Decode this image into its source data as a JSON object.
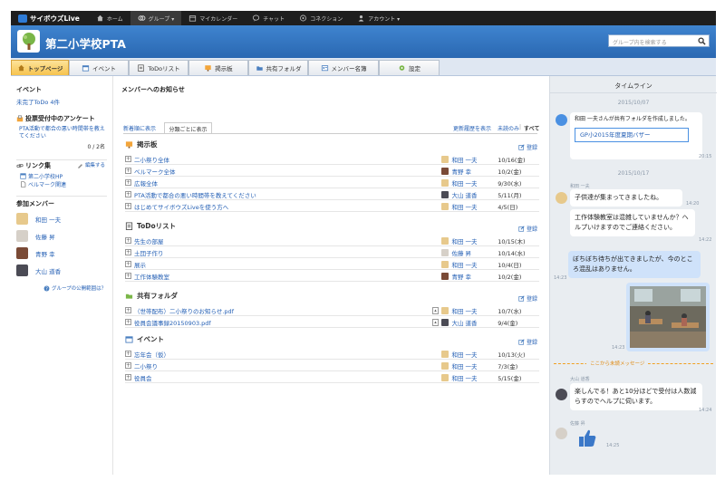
{
  "topbar": {
    "brand": "サイボウズLive",
    "nav": [
      {
        "label": "ホーム",
        "icon": "home-icon"
      },
      {
        "label": "グループ ▾",
        "icon": "group-icon"
      },
      {
        "label": "マイカレンダー",
        "icon": "calendar-icon"
      },
      {
        "label": "チャット",
        "icon": "chat-icon"
      },
      {
        "label": "コネクション",
        "icon": "connection-icon"
      },
      {
        "label": "アカウント ▾",
        "icon": "account-icon"
      }
    ]
  },
  "header": {
    "group_name": "第二小学校PTA",
    "search_placeholder": "グループ内を検索する"
  },
  "tabs": [
    {
      "label": "トップページ",
      "icon": "home-icon"
    },
    {
      "label": "イベント",
      "icon": "event-icon"
    },
    {
      "label": "ToDoリスト",
      "icon": "todo-icon"
    },
    {
      "label": "掲示板",
      "icon": "board-icon"
    },
    {
      "label": "共有フォルダ",
      "icon": "folder-icon"
    },
    {
      "label": "メンバー名簿",
      "icon": "members-icon"
    },
    {
      "label": "設定",
      "icon": "settings-icon"
    }
  ],
  "left": {
    "event_title": "イベント",
    "todo_incomplete": "未完了ToDo 4件",
    "survey_title": "投票受付中のアンケート",
    "survey_item": "PTA活動で都合の悪い時間帯を教えてください",
    "survey_count": "0 / 2名",
    "links_title": "リンク集",
    "links_edit": "編集する",
    "links": [
      "第二小学校HP",
      "ベルマーク関連"
    ],
    "members_title": "参加メンバー",
    "members": [
      "和田 一夫",
      "佐藤 昇",
      "青野 幸",
      "大山 道香"
    ],
    "public_scope": "グループの公開範囲は？"
  },
  "mid": {
    "title": "メンバーへのお知らせ",
    "view_newest": "新着順に表示",
    "view_category": "分類ごとに表示",
    "show_history": "更新履歴を表示",
    "unread_only": "未読のみ",
    "all": "すべて",
    "register": "登録",
    "categories": [
      {
        "name": "掲示板",
        "icon": "board-icon",
        "rows": [
          {
            "title": "二小祭り全体",
            "who": "和田 一夫",
            "date": "10/16(金)"
          },
          {
            "title": "ベルマーク全体",
            "who": "青野 幸",
            "date": "10/2(金)"
          },
          {
            "title": "広報全体",
            "who": "和田 一夫",
            "date": "9/30(水)"
          },
          {
            "title": "PTA活動で都合の悪い時間帯を教えてください",
            "who": "大山 道香",
            "date": "5/11(月)"
          },
          {
            "title": "はじめてサイボウズLiveを使う方へ",
            "who": "和田 一夫",
            "date": "4/5(日)"
          }
        ]
      },
      {
        "name": "ToDoリスト",
        "icon": "todo-icon",
        "rows": [
          {
            "title": "先生の部屋",
            "who": "和田 一夫",
            "date": "10/15(木)"
          },
          {
            "title": "土団子作り",
            "who": "佐藤 昇",
            "date": "10/14(水)"
          },
          {
            "title": "展示",
            "who": "和田 一夫",
            "date": "10/4(日)"
          },
          {
            "title": "工作体験教室",
            "who": "青野 幸",
            "date": "10/2(金)"
          }
        ]
      },
      {
        "name": "共有フォルダ",
        "icon": "folder-icon",
        "rows": [
          {
            "title": "（世帯配布）二小祭りのお知らせ.pdf",
            "who": "和田 一夫",
            "date": "10/7(水)"
          },
          {
            "title": "役員会議事録20150903.pdf",
            "who": "大山 道香",
            "date": "9/4(金)"
          }
        ]
      },
      {
        "name": "イベント",
        "icon": "event-icon",
        "rows": [
          {
            "title": "忘年会（仮）",
            "who": "和田 一夫",
            "date": "10/13(火)"
          },
          {
            "title": "二小祭り",
            "who": "和田 一夫",
            "date": "7/3(金)"
          },
          {
            "title": "役員会",
            "who": "和田 一夫",
            "date": "5/15(金)"
          }
        ]
      }
    ]
  },
  "timeline": {
    "title": "タイムライン",
    "date1": "2015/10/07",
    "sys_msg": "和田 一夫さんが共有フォルダを作成しました。",
    "sys_time": "20:15",
    "folder_name": "GP小2015年度夏期バザー",
    "date2": "2015/10/17",
    "m1_name": "和田 一夫",
    "m1_text": "子供達が集まってきましたね。",
    "m1_time": "14:20",
    "m2_text": "工作体験教室は混雑していませんか？ヘルプいけますのでご連絡ください。",
    "m2_time": "14:22",
    "m3_text": "ぼちぼち待ちが出てきましたが、今のところ混乱はありません。",
    "m3_time": "14:23",
    "photo_time": "14:23",
    "unread_divider": "ここから未読メッセージ",
    "m4_name": "大山 道香",
    "m4_text": "楽しんでる！あと10分ほどで受付は人数減らすのでヘルプに伺います。",
    "m4_time": "14:24",
    "m5_name": "佐藤 昇",
    "m5_time": "14:25"
  },
  "colors": {
    "accent": "#2a68b2",
    "tab_active": "#f6c34e",
    "link": "#2560b5"
  }
}
